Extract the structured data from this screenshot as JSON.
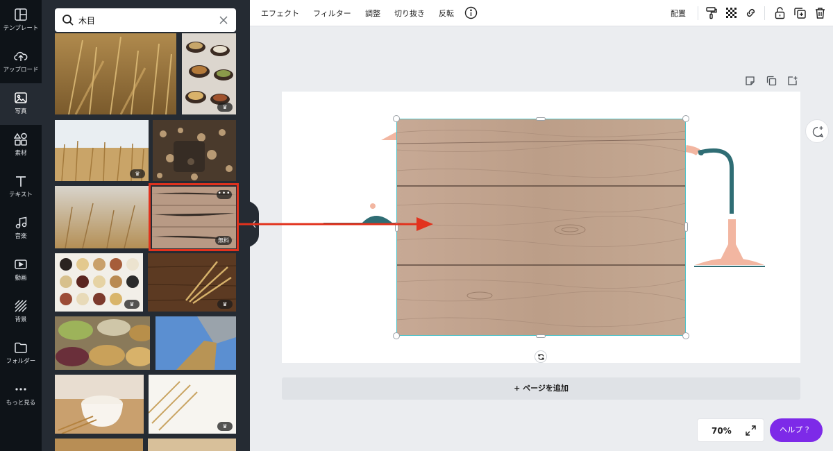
{
  "rail": {
    "items": [
      {
        "label": "テンプレート",
        "icon": "layout-icon"
      },
      {
        "label": "アップロード",
        "icon": "cloud-upload-icon"
      },
      {
        "label": "写真",
        "icon": "image-icon",
        "active": true
      },
      {
        "label": "素材",
        "icon": "shapes-icon"
      },
      {
        "label": "テキスト",
        "icon": "text-icon"
      },
      {
        "label": "音楽",
        "icon": "music-icon"
      },
      {
        "label": "動画",
        "icon": "video-icon"
      },
      {
        "label": "背景",
        "icon": "background-icon"
      },
      {
        "label": "フォルダー",
        "icon": "folder-icon"
      },
      {
        "label": "もっと見る",
        "icon": "more-dots-icon"
      }
    ]
  },
  "search": {
    "value": "木目",
    "placeholder": ""
  },
  "thumbnails": {
    "badges": {
      "crown": "♛",
      "free": "無料",
      "more": "•••"
    }
  },
  "toolbar": {
    "effect": "エフェクト",
    "filter": "フィルター",
    "adjust": "調整",
    "crop": "切り抜き",
    "flip": "反転",
    "arrange": "配置"
  },
  "canvas": {
    "add_page": "+ ページを追加"
  },
  "footer": {
    "zoom": "70%",
    "help": "ヘルプ ？"
  },
  "colors": {
    "accent": "#7d2ae8",
    "rail": "#0e1318",
    "panel": "#252b33",
    "highlight": "#e2321d",
    "selection": "#4fc3c9"
  }
}
